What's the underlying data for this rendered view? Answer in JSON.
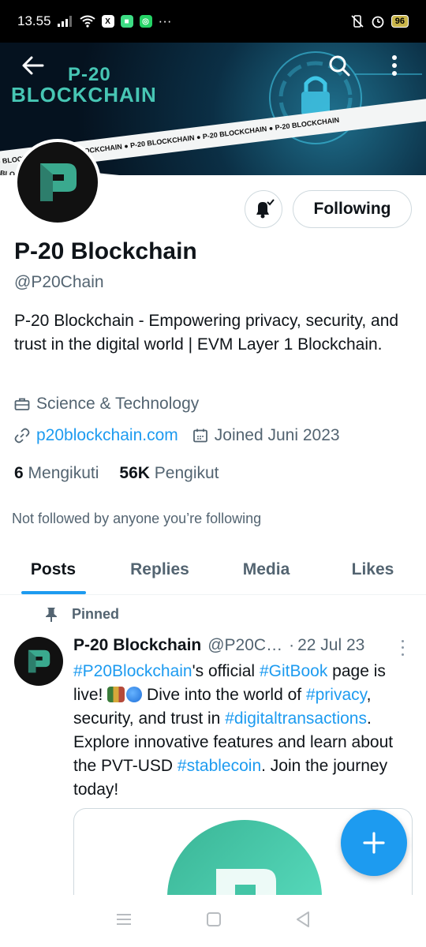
{
  "status_bar": {
    "time": "13.55",
    "battery": "96",
    "more": "···"
  },
  "banner": {
    "line1": "P-20",
    "line2": "BLOCKCHAIN",
    "ribbon_text": "P-20 BLOCKCHAIN  ●  P-20 BLOCKCHAIN  ●  P-20 BLOCKCHAIN  ●  P-20 BLOCKCHAIN  ●  P-20 BLOCKCHAIN"
  },
  "profile": {
    "name": "P-20 Blockchain",
    "handle": "@P20Chain",
    "bio": "P-20 Blockchain - Empowering privacy, security, and trust in the digital world | EVM Layer 1 Blockchain.",
    "category": "Science & Technology",
    "website": "p20blockchain.com",
    "joined": "Joined Juni 2023",
    "following_count": "6",
    "following_label": "Mengikuti",
    "followers_count": "56K",
    "followers_label": "Pengikut",
    "not_followed": "Not followed by anyone you’re following",
    "follow_button": "Following"
  },
  "tabs": [
    "Posts",
    "Replies",
    "Media",
    "Likes"
  ],
  "tweet": {
    "pinned_label": "Pinned",
    "name": "P-20 Blockchain",
    "handle": "@P20C…",
    "dot": "·",
    "date": "22 Jul 23",
    "tag1": "#P20Blockchain",
    "t1": "'s official ",
    "tag2": "#GitBook",
    "t2": " page is live! ",
    "t3": " Dive into the world of ",
    "tag3": "#privacy",
    "t4": ", security, and trust in ",
    "tag4": "#digitaltransactions",
    "t5": ". Explore innovative features and learn about the PVT-USD ",
    "tag5": "#stablecoin",
    "t6": ". Join the journey today!"
  },
  "colors": {
    "accent": "#1d9bf0",
    "brand_teal": "#47c6b4",
    "text_secondary": "#536471"
  }
}
